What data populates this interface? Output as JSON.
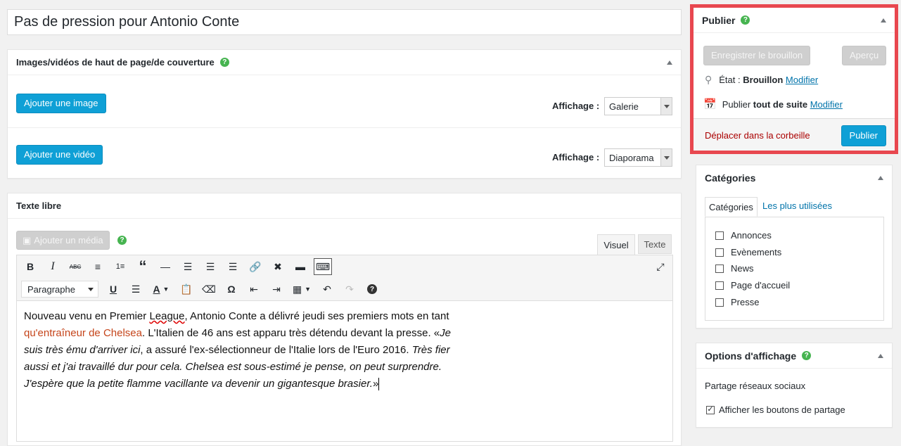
{
  "post": {
    "title": "Pas de pression pour Antonio Conte"
  },
  "cover_box": {
    "title": "Images/vidéos de haut de page/de couverture",
    "add_image_label": "Ajouter une image",
    "add_video_label": "Ajouter une vidéo",
    "display_label_1": "Affichage :",
    "display_value_1": "Galerie",
    "display_label_2": "Affichage :",
    "display_value_2": "Diaporama"
  },
  "editor_box": {
    "title": "Texte libre",
    "add_media_label": "Ajouter un média",
    "tab_visual": "Visuel",
    "tab_text": "Texte",
    "format_value": "Paragraphe",
    "content": {
      "p1": "Nouveau venu en Premier ",
      "p1_league": "League",
      "p1b": ", Antonio Conte a délivré jeudi ses premiers mots en tant",
      "p2_link": "qu'entraîneur de Chelsea",
      "p2b": ". L'Italien de 46 ans est apparu très détendu devant la presse. «",
      "p2_italic": "Je",
      "p3_italic": "suis très ému d'arriver ici",
      "p3b": ", a assuré l'ex-sélectionneur de l'Italie lors de l'Euro 2016. ",
      "p3_italic2": "Très fier",
      "p4_italic": "aussi et j'ai travaillé dur pour cela. Chelsea est sous-estimé je pense, on peut surprendre.",
      "p5_italic": "J'espère que la petite flamme vacillante va devenir un gigantesque brasier.",
      "p5_end": "»"
    }
  },
  "publish_box": {
    "title": "Publier",
    "save_draft_label": "Enregistrer le brouillon",
    "preview_label": "Aperçu",
    "status_label": "État :",
    "status_value": "Brouillon",
    "status_edit": "Modifier",
    "publish_prefix": "Publier",
    "publish_when": "tout de suite",
    "publish_edit": "Modifier",
    "trash_label": "Déplacer dans la corbeille",
    "publish_label": "Publier",
    "highlight_color": "#e8474f"
  },
  "categories_box": {
    "title": "Catégories",
    "tab_all": "Catégories",
    "tab_popular": "Les plus utilisées",
    "items": [
      "Annonces",
      "Evènements",
      "News",
      "Page d'accueil",
      "Presse"
    ]
  },
  "display_box": {
    "title": "Options d'affichage",
    "section_label": "Partage réseaux sociaux",
    "share_label": "Afficher les boutons de partage"
  },
  "colors": {
    "accent": "#0fa0d6",
    "link": "#0073aa",
    "danger": "#a00",
    "help": "#46b450"
  }
}
